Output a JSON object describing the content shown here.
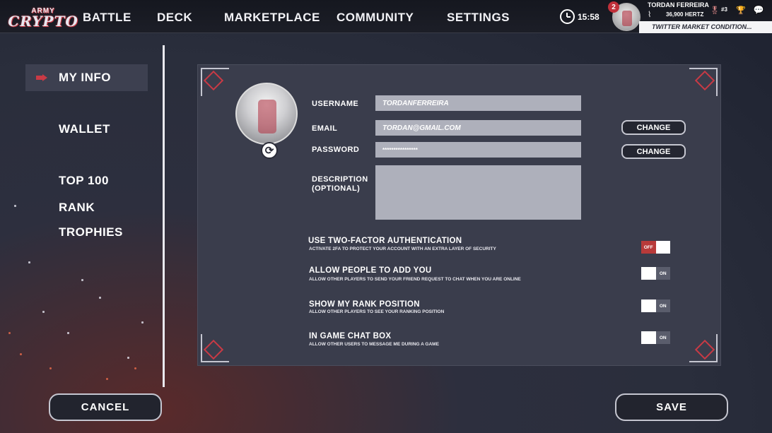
{
  "app": {
    "logo_line1": "ARMY",
    "logo_line2": "CRYPTO"
  },
  "nav": {
    "battle": "BATTLE",
    "deck": "DECK",
    "marketplace": "MARKETPLACE",
    "community": "COMMUNITY",
    "settings": "SETTINGS"
  },
  "status": {
    "time": "15:58",
    "notifications": "2",
    "player_name": "TORDAN FERREIRA",
    "hertz": "36,900 HERTZ",
    "rank": "#3",
    "ticker": "TWITTER MARKET CONDITION..."
  },
  "sidebar": {
    "items": [
      {
        "label": "MY INFO"
      },
      {
        "label": "WALLET"
      },
      {
        "label": "TOP 100 RANK"
      },
      {
        "label": "TROPHIES"
      }
    ]
  },
  "form": {
    "username_label": "USERNAME",
    "username_value": "TORDANFERREIRA",
    "email_label": "EMAIL",
    "email_value": "TORDAN@GMAIL.COM",
    "password_label": "PASSWORD",
    "password_value": "****************",
    "description_label_1": "DESCRIPTION",
    "description_label_2": "(OPTIONAL)",
    "change_email": "CHANGE",
    "change_password": "CHANGE"
  },
  "options": [
    {
      "title": "USE TWO-FACTOR AUTHENTICATION",
      "subtitle": "ACTIVATE 2FA TO PROTECT YOUR ACCOUNT WITH AN EXTRA LAYER OF SECURITY",
      "state": "OFF"
    },
    {
      "title": "ALLOW PEOPLE TO ADD YOU",
      "subtitle": "ALLOW OTHER PLAYERS TO SEND YOUR FRIEND REQUEST TO CHAT WHEN YOU ARE ONLINE",
      "state": "ON"
    },
    {
      "title": "SHOW MY RANK POSITION",
      "subtitle": "ALLOW OTHER PLAYERS TO SEE YOUR RANKING POSITION",
      "state": "ON"
    },
    {
      "title": "IN GAME CHAT BOX",
      "subtitle": "ALLOW OTHER USERS TO MESSAGE ME DURING A GAME",
      "state": "ON"
    }
  ],
  "actions": {
    "cancel": "CANCEL",
    "save": "SAVE"
  },
  "colors": {
    "accent_red": "#c93a45",
    "panel": "#3a3d4c",
    "field": "#aeb0bb"
  }
}
